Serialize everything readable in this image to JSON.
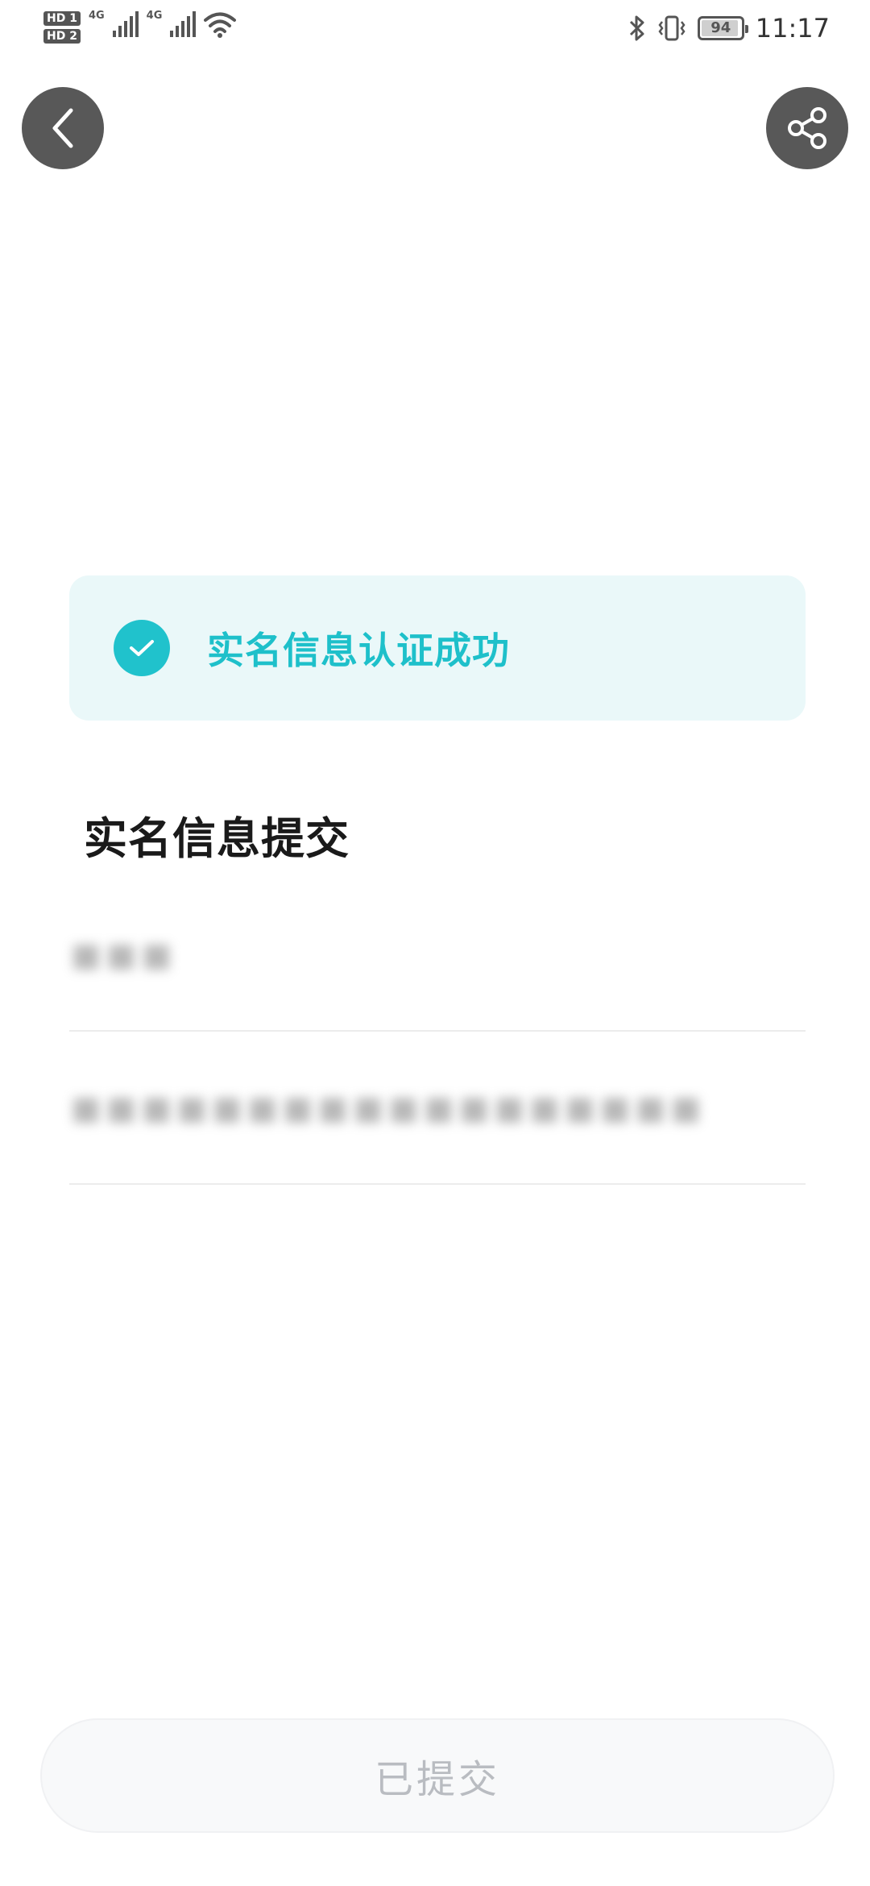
{
  "status_bar": {
    "sim1_badge": "HD 1",
    "sim2_badge": "HD 2",
    "network1": "4G",
    "network2": "4G",
    "battery": "94",
    "battery_level": 0.94,
    "time": "11:17"
  },
  "icons": {
    "back": "chevron-left-icon",
    "share": "share-icon",
    "success": "check-circle-icon"
  },
  "banner": {
    "message": "实名信息认证成功"
  },
  "section": {
    "title": "实名信息提交"
  },
  "form": {
    "name_value": "■■■",
    "id_value": "■■■■■■■■■■■■■■■■■■"
  },
  "actions": {
    "submit_label": "已提交"
  },
  "colors": {
    "accent": "#1ec0ca",
    "banner_bg": "#eaf8f9",
    "button_bg": "#585858"
  }
}
